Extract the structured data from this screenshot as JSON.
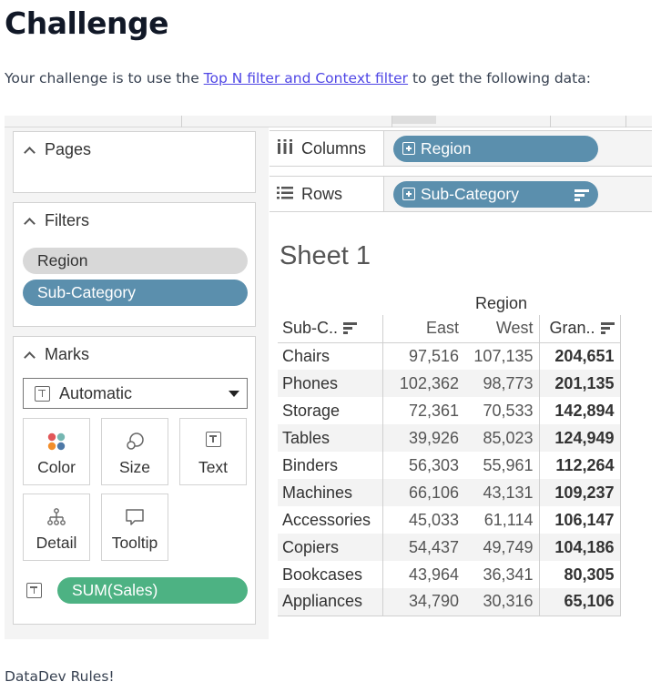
{
  "page": {
    "heading": "Challenge",
    "intro_before": "Your challenge is to use the ",
    "intro_link": "Top N filter and Context filter",
    "intro_after": " to get the following data:",
    "footer": "DataDev Rules!"
  },
  "pages_card": {
    "title": "Pages"
  },
  "filters_card": {
    "title": "Filters",
    "pills": [
      "Region",
      "Sub-Category"
    ]
  },
  "marks_card": {
    "title": "Marks",
    "mark_type": "Automatic",
    "buttons": [
      "Color",
      "Size",
      "Text",
      "Detail",
      "Tooltip"
    ],
    "text_pill": "SUM(Sales)"
  },
  "shelves": {
    "columns_label": "Columns",
    "columns_pill": "Region",
    "rows_label": "Rows",
    "rows_pill": "Sub-Category"
  },
  "view": {
    "title": "Sheet 1",
    "column_group": "Region",
    "headers": [
      "Sub-C..",
      "East",
      "West",
      "Gran.."
    ],
    "rows": [
      {
        "sub": "Chairs",
        "east": "97,516",
        "west": "107,135",
        "total": "204,651"
      },
      {
        "sub": "Phones",
        "east": "102,362",
        "west": "98,773",
        "total": "201,135"
      },
      {
        "sub": "Storage",
        "east": "72,361",
        "west": "70,533",
        "total": "142,894"
      },
      {
        "sub": "Tables",
        "east": "39,926",
        "west": "85,023",
        "total": "124,949"
      },
      {
        "sub": "Binders",
        "east": "56,303",
        "west": "55,961",
        "total": "112,264"
      },
      {
        "sub": "Machines",
        "east": "66,106",
        "west": "43,131",
        "total": "109,237"
      },
      {
        "sub": "Accessories",
        "east": "45,033",
        "west": "61,114",
        "total": "106,147"
      },
      {
        "sub": "Copiers",
        "east": "54,437",
        "west": "49,749",
        "total": "104,186"
      },
      {
        "sub": "Bookcases",
        "east": "43,964",
        "west": "36,341",
        "total": "80,305"
      },
      {
        "sub": "Appliances",
        "east": "34,790",
        "west": "30,316",
        "total": "65,106"
      }
    ]
  },
  "colors": {
    "blue_pill": "#5b8fad",
    "green_pill": "#4db283",
    "link": "#4f46e5"
  }
}
